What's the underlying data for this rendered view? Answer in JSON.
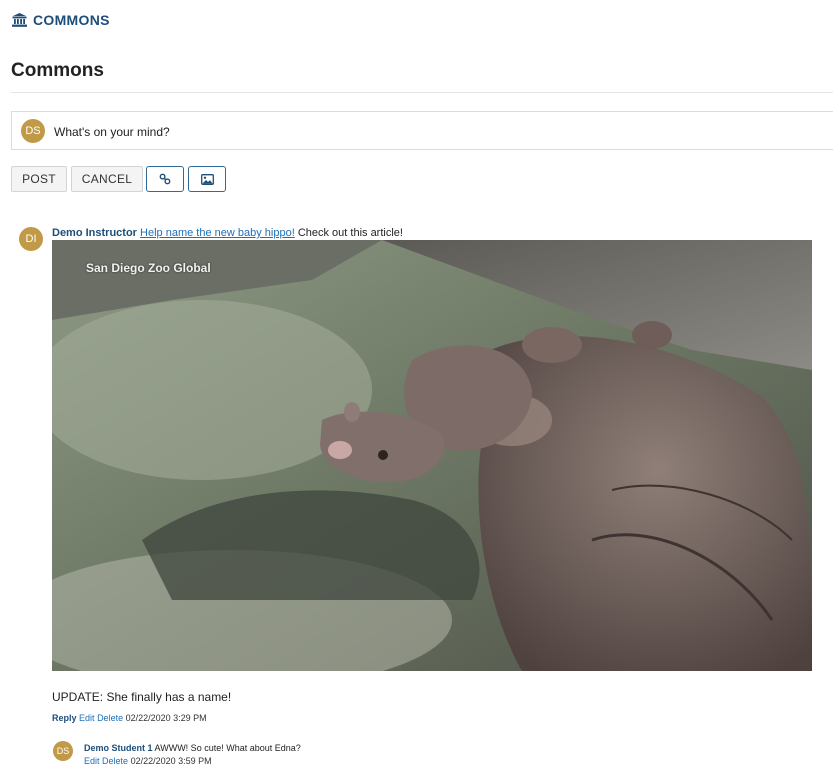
{
  "header": {
    "app_title": "COMMONS",
    "icon": "building-columns-icon"
  },
  "page": {
    "title": "Commons"
  },
  "composer": {
    "avatar_initials": "DS",
    "placeholder": "What's on your mind?"
  },
  "buttons": {
    "post": "POST",
    "cancel": "CANCEL",
    "link_icon": "link-icon",
    "image_icon": "image-icon"
  },
  "post": {
    "avatar_initials": "DI",
    "author": "Demo Instructor",
    "link_text": "Help name the new baby hippo!",
    "message": "Check out this article!",
    "image_watermark": "San Diego Zoo Global",
    "update_text": "UPDATE: She finally has a name!",
    "actions": {
      "reply": "Reply",
      "edit": "Edit",
      "delete": "Delete",
      "timestamp": "02/22/2020 3:29 PM"
    }
  },
  "reply": {
    "avatar_initials": "DS",
    "author": "Demo Student 1",
    "message": "AWWW! So cute! What about Edna?",
    "actions": {
      "edit": "Edit",
      "delete": "Delete",
      "timestamp": "02/22/2020 3:59 PM"
    }
  },
  "colors": {
    "accent": "#1d4e7a",
    "link": "#1d6fb8",
    "avatar": "#c19a47"
  }
}
